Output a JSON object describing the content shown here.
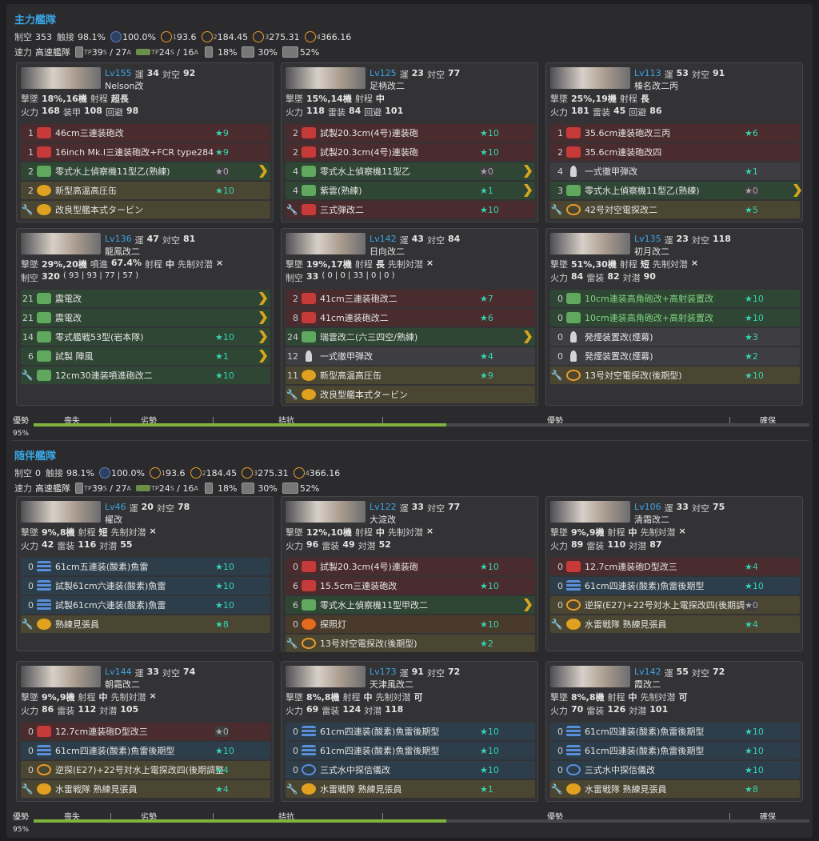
{
  "fleets": [
    {
      "title": "主力艦隊",
      "stats": {
        "seiku_label": "制空",
        "seiku": "353",
        "shokusetsu_label": "触接",
        "shokusetsu": "98.1%",
        "c100": "100.0%",
        "c1": "93.6",
        "c2": "184.45",
        "c3": "275.31",
        "c4": "366.16",
        "speed_label": "速力",
        "speed": "高速艦隊",
        "tp_label": "TP",
        "tp1": "39",
        "tp1s": "S",
        "tp2": "27",
        "tp2s": "A",
        "tp3": "24",
        "tp3s": "S",
        "tp4": "16",
        "tp4s": "A",
        "p1": "18%",
        "p2": "30%",
        "p3": "52%"
      },
      "ships": [
        {
          "lv": "Lv155",
          "luck_label": "運",
          "luck": "34",
          "asw_label": "対空",
          "asw": "92",
          "name": "Nelson改",
          "l1": "撃墜",
          "l1v": "18%,16機",
          "l2": "射程",
          "l2v": "超長",
          "l3": "火力",
          "l3v": "168",
          "l4": "装甲",
          "l4v": "108",
          "l5": "回避",
          "l5v": "98",
          "eq": [
            {
              "n": "1",
              "c": "red",
              "name": "46cm三連装砲改",
              "star": "★9"
            },
            {
              "n": "1",
              "c": "red",
              "name": "16inch Mk.I三連装砲改+FCR type284",
              "star": "★9"
            },
            {
              "n": "2",
              "c": "green",
              "name": "零式水上偵察機11型乙(熟練)",
              "star": "★0",
              "sg": true,
              "chev": true
            },
            {
              "n": "2",
              "c": "olive",
              "name": "新型高温高圧缶",
              "star": "★10"
            },
            {
              "n": "",
              "c": "olive",
              "name": "改良型艦本式タービン",
              "star": "",
              "wr": true
            }
          ]
        },
        {
          "lv": "Lv125",
          "luck_label": "運",
          "luck": "23",
          "asw_label": "対空",
          "asw": "77",
          "name": "足柄改二",
          "l1": "撃墜",
          "l1v": "15%,14機",
          "l2": "射程",
          "l2v": "中",
          "l3": "火力",
          "l3v": "118",
          "l4": "雷装",
          "l4v": "84",
          "l5": "回避",
          "l5v": "101",
          "eq": [
            {
              "n": "2",
              "c": "red",
              "name": "試製20.3cm(4号)連装砲",
              "star": "★10"
            },
            {
              "n": "2",
              "c": "red",
              "name": "試製20.3cm(4号)連装砲",
              "star": "★10"
            },
            {
              "n": "4",
              "c": "green",
              "name": "零式水上偵察機11型乙",
              "star": "★0",
              "sg": true,
              "chev": true
            },
            {
              "n": "4",
              "c": "green",
              "name": "紫雲(熟練)",
              "star": "★1",
              "chev": true
            },
            {
              "n": "",
              "c": "red",
              "name": "三式弾改二",
              "star": "★10",
              "wr": true
            }
          ]
        },
        {
          "lv": "Lv113",
          "luck_label": "運",
          "luck": "53",
          "asw_label": "対空",
          "asw": "91",
          "name": "榛名改二丙",
          "l1": "撃墜",
          "l1v": "25%,19機",
          "l2": "射程",
          "l2v": "長",
          "l3": "火力",
          "l3v": "181",
          "l4": "雷装",
          "l4v": "45",
          "l5": "回避",
          "l5v": "86",
          "eq": [
            {
              "n": "1",
              "c": "red",
              "name": "35.6cm連装砲改三丙",
              "star": "★6"
            },
            {
              "n": "2",
              "c": "red",
              "name": "35.6cm連装砲改四",
              "star": ""
            },
            {
              "n": "4",
              "c": "grey",
              "name": "一式徹甲弾改",
              "star": "★1"
            },
            {
              "n": "3",
              "c": "green",
              "name": "零式水上偵察機11型乙(熟練)",
              "star": "★0",
              "sg": true,
              "chev2": true
            },
            {
              "n": "",
              "c": "olive",
              "ring": true,
              "name": "42号対空電探改二",
              "star": "★5",
              "wr": true
            }
          ]
        },
        {
          "lv": "Lv136",
          "luck_label": "運",
          "luck": "47",
          "asw_label": "対空",
          "asw": "81",
          "name": "龍鳳改二",
          "l1": "撃墜",
          "l1v": "29%,20機",
          "l2": "噴進",
          "l2v": "67.4%",
          "l3": "射程",
          "l3v": "中",
          "l4": "先制対潜",
          "l4v": "×",
          "seiku": "320",
          "seiku_d": "( 93 | 93 | 77 | 57 )",
          "eq": [
            {
              "n": "21",
              "c": "green",
              "name": "震電改",
              "star": "",
              "chev": true
            },
            {
              "n": "21",
              "c": "green",
              "name": "震電改",
              "star": "",
              "chev": true
            },
            {
              "n": "14",
              "c": "green",
              "name": "零式艦戦53型(岩本隊)",
              "star": "★10",
              "chev": true
            },
            {
              "n": "6",
              "c": "green",
              "name": "試製 陣風",
              "star": "★1",
              "chev": true
            },
            {
              "n": "",
              "c": "green",
              "name": "12cm30連装噴進砲改二",
              "star": "★10",
              "wr": true
            }
          ]
        },
        {
          "lv": "Lv142",
          "luck_label": "運",
          "luck": "43",
          "asw_label": "対空",
          "asw": "84",
          "name": "日向改二",
          "l1": "撃墜",
          "l1v": "19%,17機",
          "l2": "射程",
          "l2v": "長",
          "l3": "先制対潜",
          "l3v": "×",
          "seiku": "33",
          "seiku_d": "( 0 | 0 | 33 | 0 | 0 )",
          "eq": [
            {
              "n": "2",
              "c": "red",
              "name": "41cm三連装砲改二",
              "star": "★7"
            },
            {
              "n": "8",
              "c": "red",
              "name": "41cm連装砲改二",
              "star": "★6"
            },
            {
              "n": "24",
              "c": "green",
              "name": "瑞雲改二(六三四空/熟練)",
              "star": "",
              "chev": true
            },
            {
              "n": "12",
              "c": "grey",
              "name": "一式徹甲弾改",
              "star": "★4"
            },
            {
              "n": "11",
              "c": "olive",
              "name": "新型高温高圧缶",
              "star": "★9"
            },
            {
              "n": "",
              "c": "olive",
              "name": "改良型艦本式タービン",
              "star": "",
              "wr": true
            }
          ]
        },
        {
          "lv": "Lv135",
          "luck_label": "運",
          "luck": "23",
          "asw_label": "対空",
          "asw": "118",
          "name": "初月改二",
          "l1": "撃墜",
          "l1v": "51%,30機",
          "l2": "射程",
          "l2v": "短",
          "l3": "先制対潜",
          "l3v": "×",
          "l4": "火力",
          "l4v": "84",
          "l5": "雷装",
          "l5v": "82",
          "l6": "対潜",
          "l6v": "90",
          "eq": [
            {
              "n": "0",
              "c": "green",
              "name": "10cm連装高角砲改+高射装置改",
              "star": "★10",
              "gt": true
            },
            {
              "n": "0",
              "c": "green",
              "name": "10cm連装高角砲改+高射装置改",
              "star": "★10",
              "gt": true
            },
            {
              "n": "0",
              "c": "grey",
              "name": "発煙装置改(煙幕)",
              "star": "★3"
            },
            {
              "n": "0",
              "c": "grey",
              "name": "発煙装置改(煙幕)",
              "star": "★2"
            },
            {
              "n": "",
              "c": "olive",
              "ring": true,
              "name": "13号対空電探改(後期型)",
              "star": "★10",
              "wr": true
            }
          ]
        }
      ],
      "bar": {
        "label": "優勢",
        "pct": "95%",
        "l1": "喪失",
        "l2": "劣勢",
        "l3": "拮抗",
        "l4": "優勢",
        "l5": "確保"
      }
    },
    {
      "title": "随伴艦隊",
      "stats": {
        "seiku_label": "制空",
        "seiku": "0",
        "shokusetsu_label": "触接",
        "shokusetsu": "98.1%",
        "c100": "100.0%",
        "c1": "93.6",
        "c2": "184.45",
        "c3": "275.31",
        "c4": "366.16",
        "speed_label": "速力",
        "speed": "高速艦隊",
        "tp_label": "TP",
        "tp1": "39",
        "tp1s": "S",
        "tp2": "27",
        "tp2s": "A",
        "tp3": "24",
        "tp3s": "S",
        "tp4": "16",
        "tp4s": "A",
        "p1": "18%",
        "p2": "30%",
        "p3": "52%"
      },
      "ships": [
        {
          "lv": "Lv46",
          "luck_label": "運",
          "luck": "20",
          "asw_label": "対空",
          "asw": "78",
          "name": "櫂改",
          "l1": "撃墜",
          "l1v": "9%,8機",
          "l2": "射程",
          "l2v": "短",
          "l3": "先制対潜",
          "l3v": "×",
          "l4": "火力",
          "l4v": "42",
          "l5": "雷装",
          "l5v": "116",
          "l6": "対潜",
          "l6v": "55",
          "eq": [
            {
              "n": "0",
              "c": "teal",
              "name": "61cm五連装(酸素)魚雷",
              "star": "★10"
            },
            {
              "n": "0",
              "c": "teal",
              "name": "試製61cm六連装(酸素)魚雷",
              "star": "★10"
            },
            {
              "n": "0",
              "c": "teal",
              "name": "試製61cm六連装(酸素)魚雷",
              "star": "★10"
            },
            {
              "n": "",
              "c": "olive",
              "name": "熟練見張員",
              "star": "★8",
              "wr": true
            }
          ]
        },
        {
          "lv": "Lv122",
          "luck_label": "運",
          "luck": "33",
          "asw_label": "対空",
          "asw": "77",
          "name": "大淀改",
          "l1": "撃墜",
          "l1v": "12%,10機",
          "l2": "射程",
          "l2v": "中",
          "l3": "先制対潜",
          "l3v": "×",
          "l4": "火力",
          "l4v": "96",
          "l5": "雷装",
          "l5v": "49",
          "l6": "対潜",
          "l6v": "52",
          "eq": [
            {
              "n": "0",
              "c": "red",
              "name": "試製20.3cm(4号)連装砲",
              "star": "★10"
            },
            {
              "n": "6",
              "c": "red",
              "name": "15.5cm三連装砲改",
              "star": "★10"
            },
            {
              "n": "6",
              "c": "green",
              "name": "零式水上偵察機11型甲改二",
              "star": "",
              "chev": true
            },
            {
              "n": "0",
              "c": "orange",
              "name": "探照灯",
              "star": "★10"
            },
            {
              "n": "",
              "c": "olive",
              "ring": true,
              "name": "13号対空電探改(後期型)",
              "star": "★2",
              "wr": true
            }
          ]
        },
        {
          "lv": "Lv106",
          "luck_label": "運",
          "luck": "33",
          "asw_label": "対空",
          "asw": "75",
          "name": "清霜改二",
          "l1": "撃墜",
          "l1v": "9%,9機",
          "l2": "射程",
          "l2v": "中",
          "l3": "先制対潜",
          "l3v": "×",
          "l4": "火力",
          "l4v": "89",
          "l5": "雷装",
          "l5v": "110",
          "l6": "対潜",
          "l6v": "87",
          "eq": [
            {
              "n": "0",
              "c": "red",
              "name": "12.7cm連装砲D型改三",
              "star": "★4"
            },
            {
              "n": "0",
              "c": "teal",
              "name": "61cm四連装(酸素)魚雷後期型",
              "star": "★10"
            },
            {
              "n": "0",
              "c": "olive",
              "ring": true,
              "name": "逆探(E27)+22号対水上電探改四(後期調整",
              "star": "★0",
              "sg": true
            },
            {
              "n": "",
              "c": "olive",
              "name": "水雷戦隊 熟練見張員",
              "star": "★4",
              "wr": true
            }
          ]
        },
        {
          "lv": "Lv144",
          "luck_label": "運",
          "luck": "33",
          "asw_label": "対空",
          "asw": "74",
          "name": "朝霜改二",
          "l1": "撃墜",
          "l1v": "9%,9機",
          "l2": "射程",
          "l2v": "中",
          "l3": "先制対潜",
          "l3v": "×",
          "l4": "火力",
          "l4v": "86",
          "l5": "雷装",
          "l5v": "112",
          "l6": "対潜",
          "l6v": "105",
          "eq": [
            {
              "n": "0",
              "c": "red",
              "name": "12.7cm連装砲D型改三",
              "star": "★0",
              "sg": true
            },
            {
              "n": "0",
              "c": "teal",
              "name": "61cm四連装(酸素)魚雷後期型",
              "star": "★10"
            },
            {
              "n": "0",
              "c": "olive",
              "ring": true,
              "name": "逆探(E27)+22号対水上電探改四(後期調整",
              "star": "★4"
            },
            {
              "n": "",
              "c": "olive",
              "name": "水雷戦隊 熟練見張員",
              "star": "★4",
              "wr": true
            }
          ]
        },
        {
          "lv": "Lv173",
          "luck_label": "運",
          "luck": "91",
          "asw_label": "対空",
          "asw": "72",
          "name": "天津風改二",
          "l1": "撃墜",
          "l1v": "8%,8機",
          "l2": "射程",
          "l2v": "中",
          "l3": "先制対潜",
          "l3v": "可",
          "l4": "火力",
          "l4v": "69",
          "l5": "雷装",
          "l5v": "124",
          "l6": "対潜",
          "l6v": "118",
          "eq": [
            {
              "n": "0",
              "c": "teal",
              "name": "61cm四連装(酸素)魚雷後期型",
              "star": "★10"
            },
            {
              "n": "0",
              "c": "teal",
              "name": "61cm四連装(酸素)魚雷後期型",
              "star": "★10"
            },
            {
              "n": "0",
              "c": "teal",
              "ring2": true,
              "name": "三式水中探信儀改",
              "star": "★10"
            },
            {
              "n": "",
              "c": "olive",
              "name": "水雷戦隊 熟練見張員",
              "star": "★1",
              "wr": true
            }
          ]
        },
        {
          "lv": "Lv142",
          "luck_label": "運",
          "luck": "55",
          "asw_label": "対空",
          "asw": "72",
          "name": "霞改二",
          "l1": "撃墜",
          "l1v": "8%,8機",
          "l2": "射程",
          "l2v": "中",
          "l3": "先制対潜",
          "l3v": "可",
          "l4": "火力",
          "l4v": "70",
          "l5": "雷装",
          "l5v": "126",
          "l6": "対潜",
          "l6v": "101",
          "eq": [
            {
              "n": "0",
              "c": "teal",
              "name": "61cm四連装(酸素)魚雷後期型",
              "star": "★10"
            },
            {
              "n": "0",
              "c": "teal",
              "name": "61cm四連装(酸素)魚雷後期型",
              "star": "★10"
            },
            {
              "n": "0",
              "c": "teal",
              "ring2": true,
              "name": "三式水中探信儀改",
              "star": "★10"
            },
            {
              "n": "",
              "c": "olive",
              "name": "水雷戦隊 熟練見張員",
              "star": "★8",
              "wr": true
            }
          ]
        }
      ],
      "bar": {
        "label": "優勢",
        "pct": "95%",
        "l1": "喪失",
        "l2": "劣勢",
        "l3": "拮抗",
        "l4": "優勢",
        "l5": "確保"
      }
    }
  ]
}
